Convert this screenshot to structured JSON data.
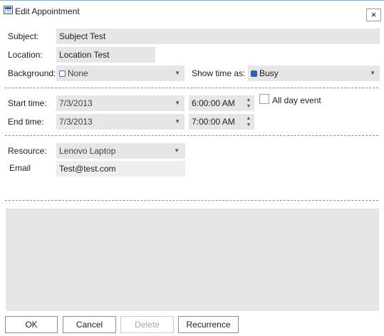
{
  "window": {
    "title": "Edit Appointment",
    "close_glyph": "×"
  },
  "subject": {
    "label": "Subject:",
    "value": "Subject Test"
  },
  "location": {
    "label": "Location:",
    "value": "Location Test"
  },
  "background": {
    "label": "Background:",
    "value": "None",
    "swatch_color": "#ffffff",
    "swatch_border": "#3a6fb8"
  },
  "show_time_as": {
    "label": "Show time as:",
    "value": "Busy",
    "swatch_color": "#2f5fb3"
  },
  "start": {
    "label": "Start time:",
    "date": "7/3/2013",
    "time": "6:00:00 AM"
  },
  "end": {
    "label": "End time:",
    "date": "7/3/2013",
    "time": "7:00:00 AM"
  },
  "all_day": {
    "label": "All day event",
    "checked": false
  },
  "resource": {
    "label": "Resource:",
    "value": "Lenovo Laptop"
  },
  "email": {
    "label": "Email",
    "value": "Test@test.com"
  },
  "buttons": {
    "ok": "OK",
    "cancel": "Cancel",
    "delete": "Delete",
    "recurrence": "Recurrence"
  },
  "glyphs": {
    "dropdown": "▼",
    "spin_up": "▲",
    "spin_down": "▼"
  },
  "colors": {
    "accent_border": "#7fb2e6",
    "field_bg": "#e6e6e6",
    "disabled_border": "#b6d3ea"
  }
}
